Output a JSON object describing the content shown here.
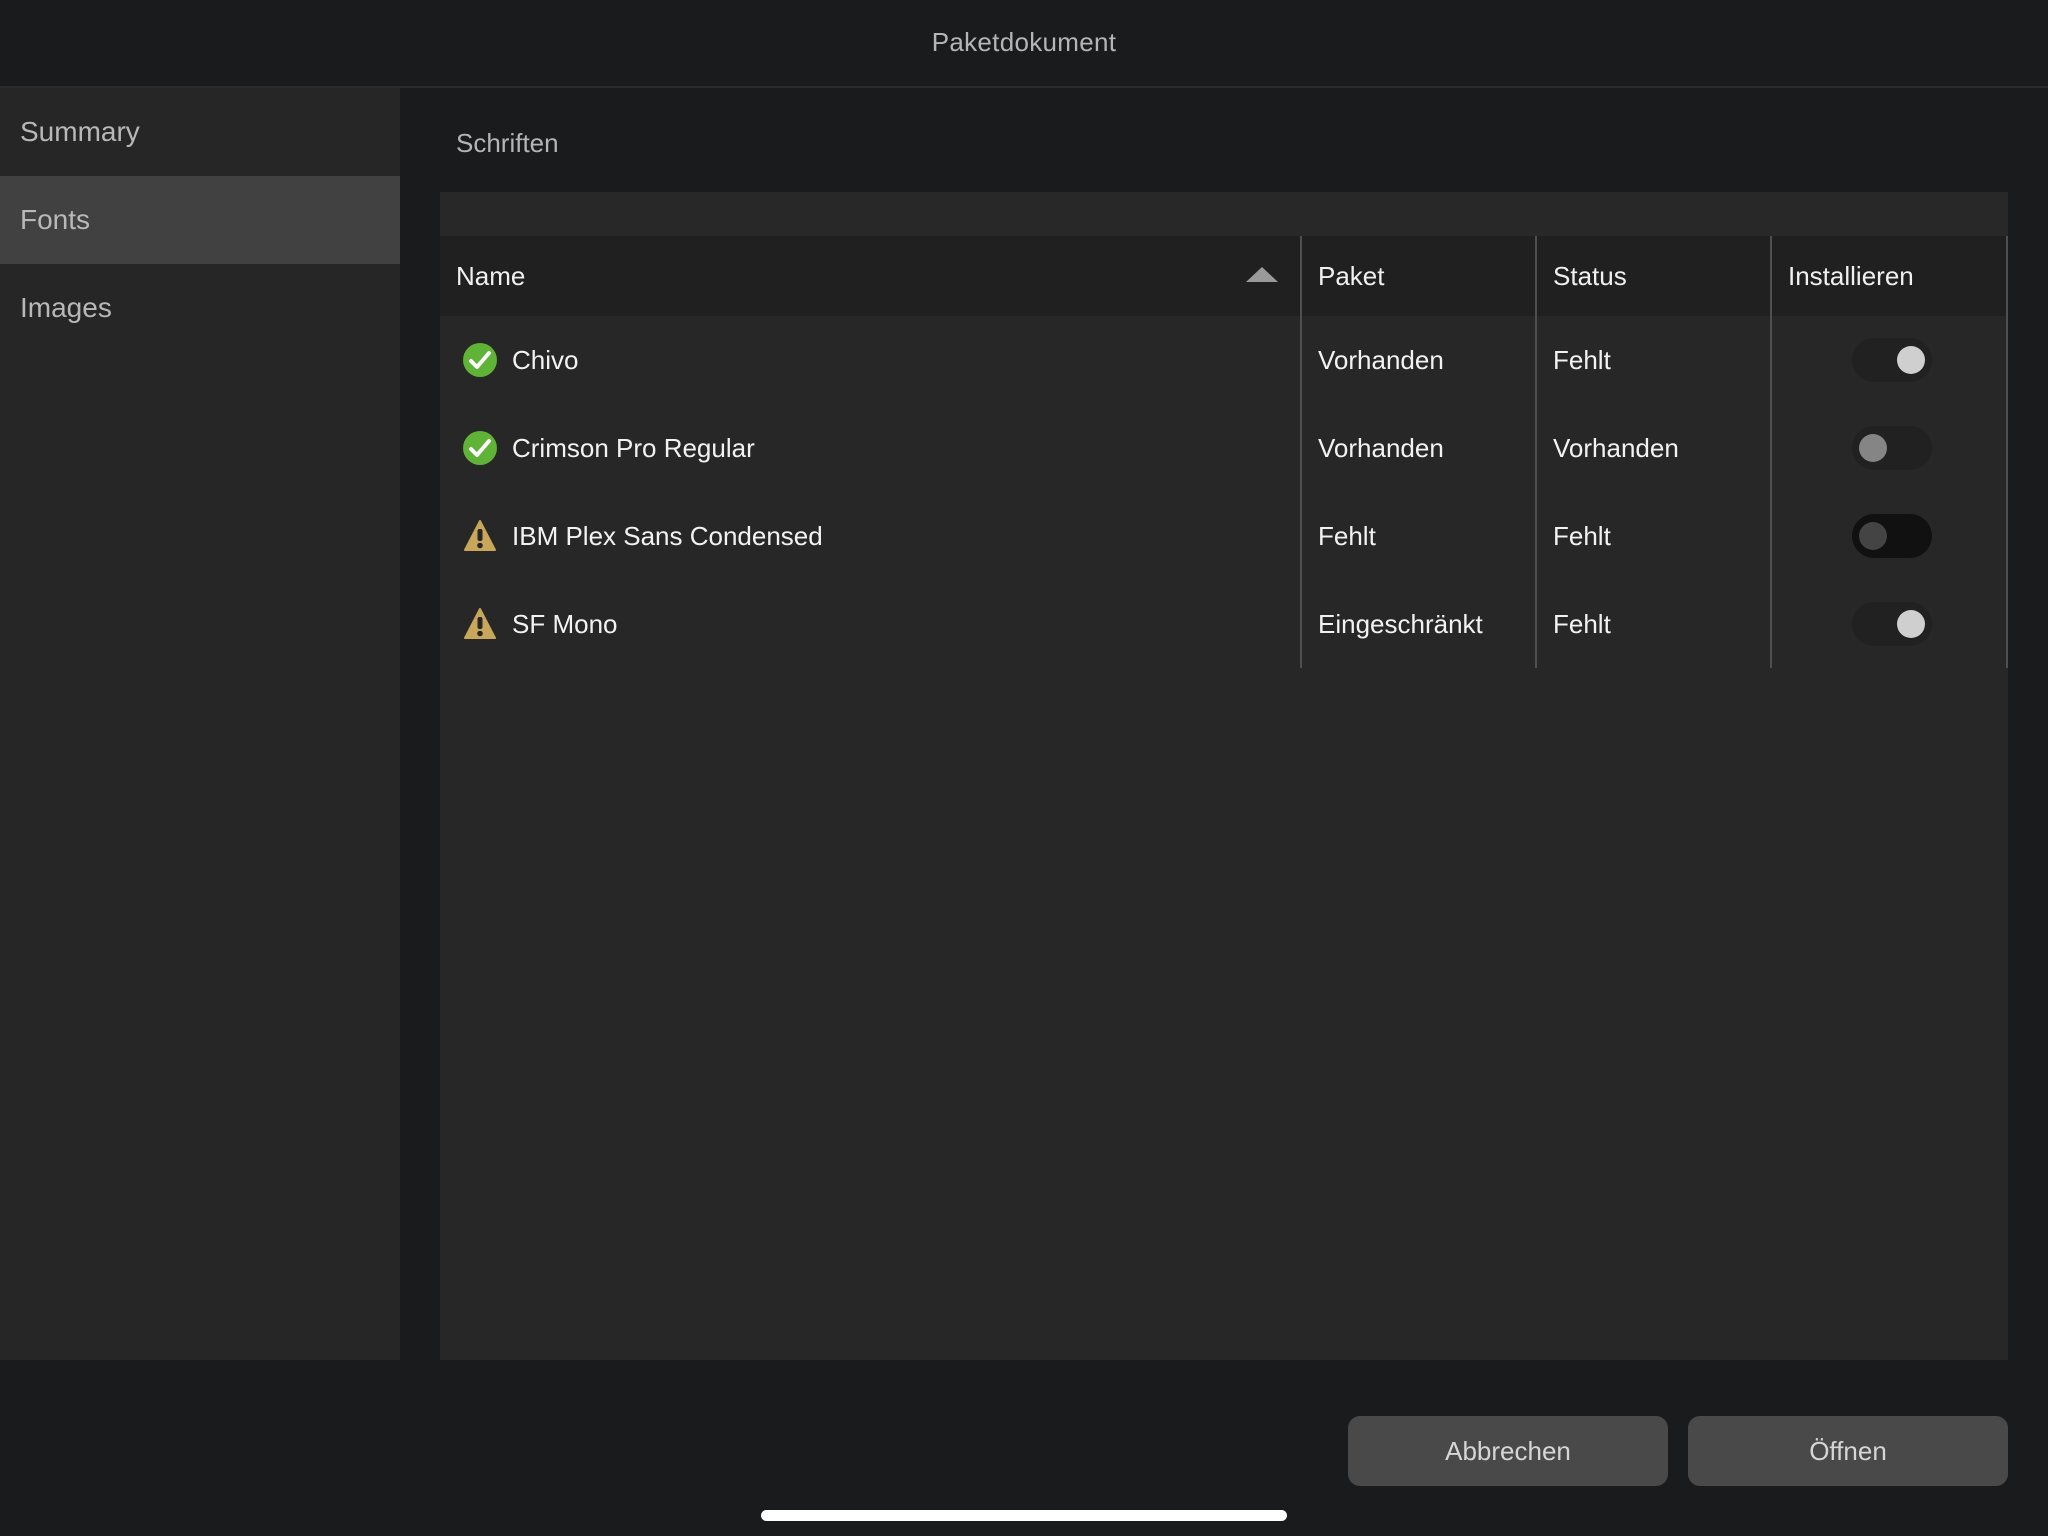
{
  "window": {
    "title": "Paketdokument"
  },
  "sidebar": {
    "items": [
      {
        "label": "Summary",
        "selected": false
      },
      {
        "label": "Fonts",
        "selected": true
      },
      {
        "label": "Images",
        "selected": false
      }
    ]
  },
  "main": {
    "section_title": "Schriften",
    "table": {
      "columns": [
        {
          "label": "Name",
          "sort": "ascending"
        },
        {
          "label": "Paket"
        },
        {
          "label": "Status"
        },
        {
          "label": "Installieren"
        }
      ],
      "rows": [
        {
          "icon": "check-circle-icon",
          "name": "Chivo",
          "paket": "Vorhanden",
          "status": "Fehlt",
          "install": "on"
        },
        {
          "icon": "check-circle-icon",
          "name": "Crimson Pro Regular",
          "paket": "Vorhanden",
          "status": "Vorhanden",
          "install": "off"
        },
        {
          "icon": "warning-triangle-icon",
          "name": "IBM Plex Sans Condensed",
          "paket": "Fehlt",
          "status": "Fehlt",
          "install": "disabled"
        },
        {
          "icon": "warning-triangle-icon",
          "name": "SF Mono",
          "paket": "Eingeschränkt",
          "status": "Fehlt",
          "install": "on"
        }
      ]
    }
  },
  "footer": {
    "cancel_label": "Abbrechen",
    "open_label": "Öffnen"
  },
  "colors": {
    "ok": "#5fb336",
    "warning": "#c9a75a",
    "background": "#1a1b1d",
    "sidebar_selected": "#414141"
  }
}
